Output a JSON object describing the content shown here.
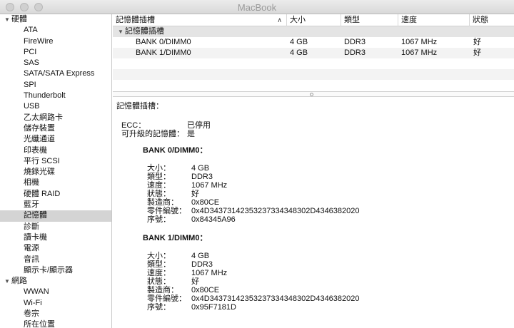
{
  "window": {
    "title": "MacBook"
  },
  "sidebar": {
    "groups": [
      {
        "label": "硬體",
        "expanded": true,
        "items": [
          "ATA",
          "FireWire",
          "PCI",
          "SAS",
          "SATA/SATA Express",
          "SPI",
          "Thunderbolt",
          "USB",
          "乙太網路卡",
          "儲存裝置",
          "光纖通道",
          "印表機",
          "平行 SCSI",
          "燒錄光碟",
          "相機",
          "硬體 RAID",
          "藍牙",
          "記憶體",
          "診斷",
          "讀卡機",
          "電源",
          "音訊",
          "顯示卡/顯示器"
        ]
      },
      {
        "label": "網路",
        "expanded": true,
        "items": [
          "WWAN",
          "Wi-Fi",
          "卷宗",
          "所在位置"
        ]
      }
    ],
    "selected": "記憶體"
  },
  "table": {
    "columns": [
      "記憶體插槽",
      "大小",
      "類型",
      "速度",
      "狀態"
    ],
    "group_label": "記憶體插槽",
    "rows": [
      {
        "name": "BANK 0/DIMM0",
        "size": "4 GB",
        "type": "DDR3",
        "speed": "1067 MHz",
        "status": "好"
      },
      {
        "name": "BANK 1/DIMM0",
        "size": "4 GB",
        "type": "DDR3",
        "speed": "1067 MHz",
        "status": "好"
      }
    ]
  },
  "detail": {
    "title": "記憶體插槽：",
    "ecc_label": "ECC：",
    "ecc_value": "已停用",
    "upgradeable_label": "可升級的記憶體：",
    "upgradeable_value": "是",
    "banks": [
      {
        "title": "BANK 0/DIMM0：",
        "fields": [
          {
            "k": "大小：",
            "v": "4 GB"
          },
          {
            "k": "類型：",
            "v": "DDR3"
          },
          {
            "k": "速度：",
            "v": "1067 MHz"
          },
          {
            "k": "狀態：",
            "v": "好"
          },
          {
            "k": "製造商：",
            "v": "0x80CE"
          },
          {
            "k": "零件編號：",
            "v": "0x4D34373142353237334348302D4346382020"
          },
          {
            "k": "序號：",
            "v": "0x84345A96"
          }
        ]
      },
      {
        "title": "BANK 1/DIMM0：",
        "fields": [
          {
            "k": "大小：",
            "v": "4 GB"
          },
          {
            "k": "類型：",
            "v": "DDR3"
          },
          {
            "k": "速度：",
            "v": "1067 MHz"
          },
          {
            "k": "狀態：",
            "v": "好"
          },
          {
            "k": "製造商：",
            "v": "0x80CE"
          },
          {
            "k": "零件編號：",
            "v": "0x4D34373142353237334348302D4346382020"
          },
          {
            "k": "序號：",
            "v": "0x95F7181D"
          }
        ]
      }
    ]
  }
}
